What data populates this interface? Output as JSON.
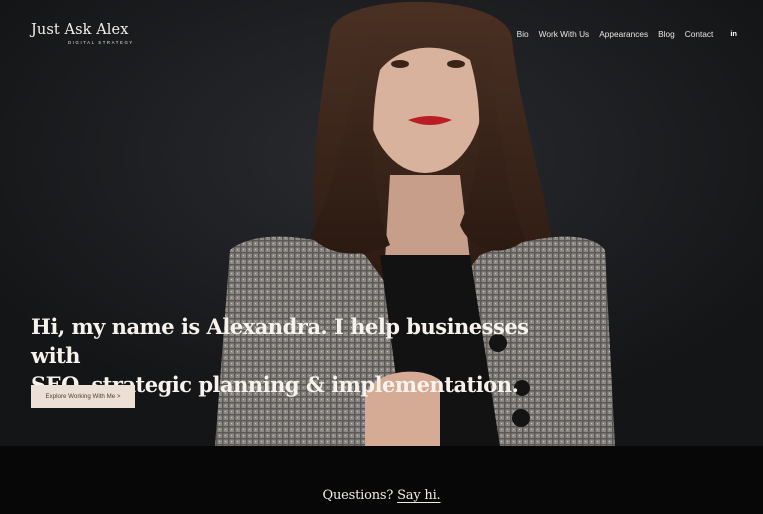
{
  "brand": {
    "name": "Just Ask Alex",
    "tagline": "DIGITAL STRATEGY"
  },
  "nav": {
    "items": [
      {
        "label": "Bio"
      },
      {
        "label": "Work With Us"
      },
      {
        "label": "Appearances"
      },
      {
        "label": "Blog"
      },
      {
        "label": "Contact"
      }
    ],
    "social_icon_label": "in"
  },
  "hero": {
    "headline_line1": "Hi, my name is Alexandra. I help businesses with",
    "headline_line2": "SEO, strategic planning & implementation.",
    "cta_label": "Explore Working With Me >"
  },
  "footer": {
    "questions_label": "Questions?",
    "say_hi_label": "Say hi."
  },
  "colors": {
    "background": "#1b1c1f",
    "cta_bg": "#ece0d6",
    "footer_bg": "#070707"
  }
}
